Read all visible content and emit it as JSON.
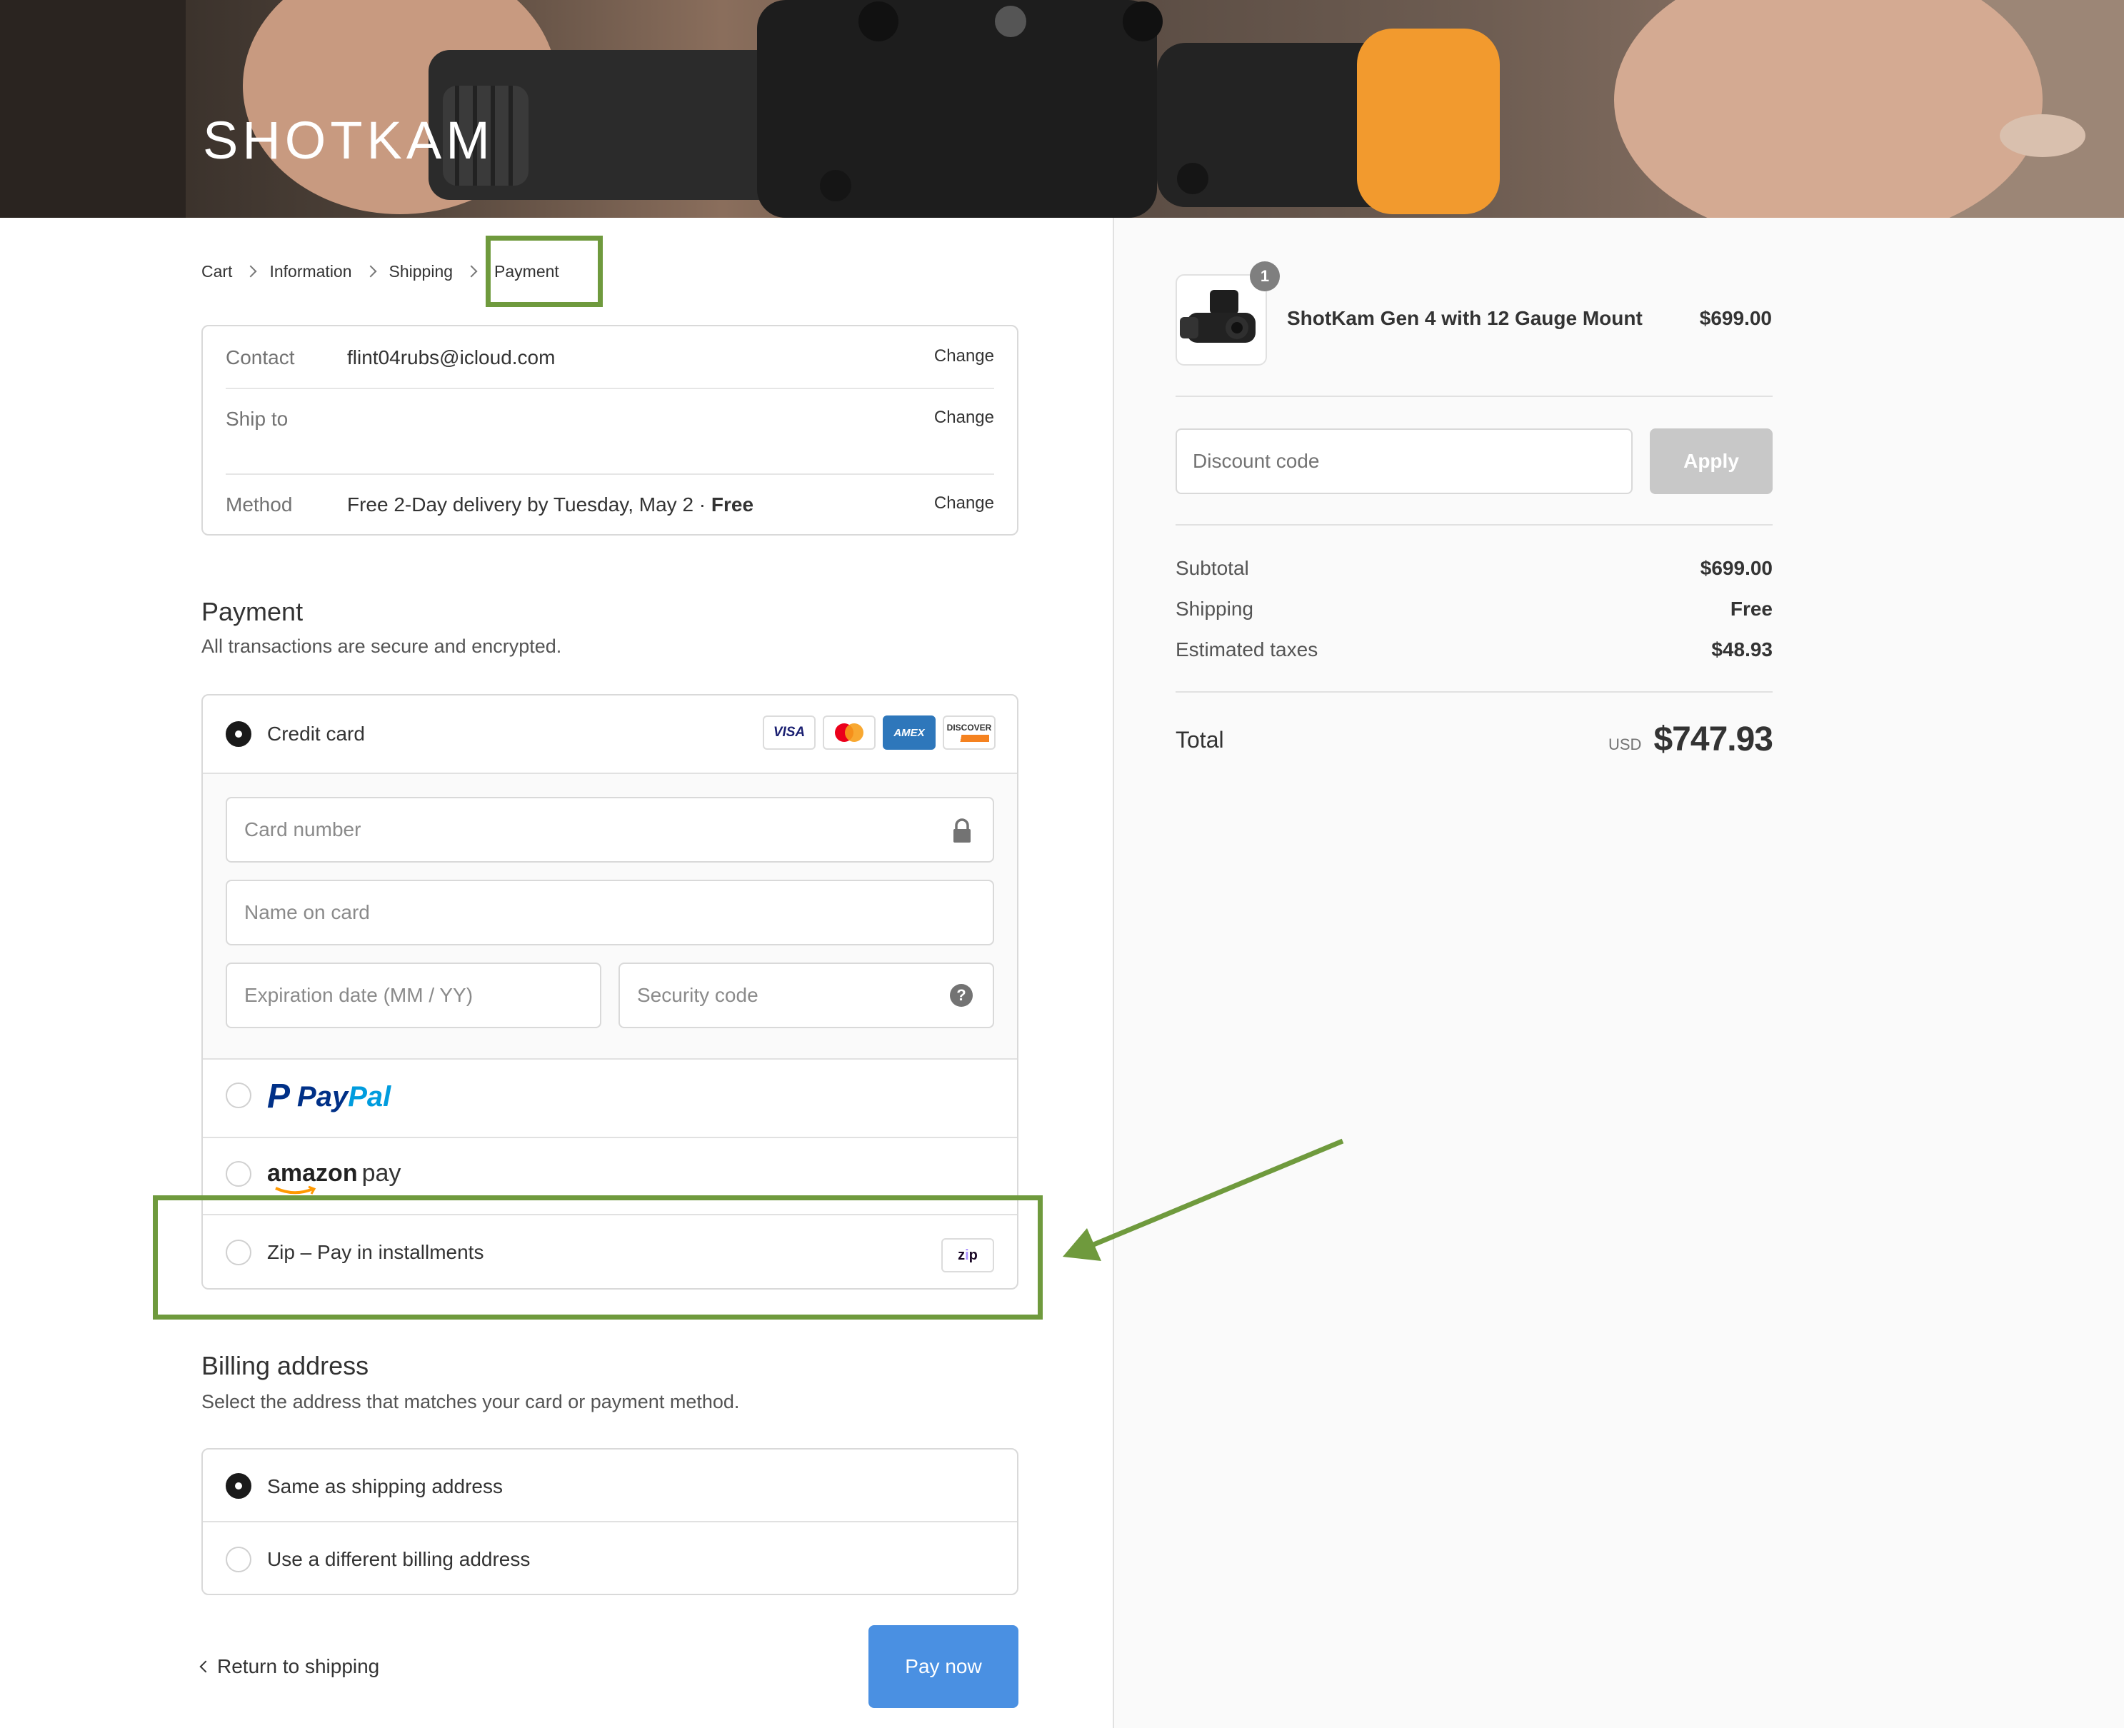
{
  "brand": {
    "logo_text": "SHOTKAM"
  },
  "breadcrumb": {
    "cart": "Cart",
    "information": "Information",
    "shipping": "Shipping",
    "payment": "Payment"
  },
  "review": {
    "contact_label": "Contact",
    "contact_value": "flint04rubs@icloud.com",
    "ship_to_label": "Ship to",
    "ship_to_value": "",
    "method_label": "Method",
    "method_value": "Free 2-Day delivery by Tuesday, May 2 ·",
    "method_price": "Free",
    "change_label": "Change"
  },
  "payment": {
    "title": "Payment",
    "subtitle": "All transactions are secure and encrypted.",
    "credit_card_label": "Credit card",
    "card_badges": {
      "visa": "VISA",
      "amex": "AMEX",
      "discover": "DISCOVER"
    },
    "card_number_placeholder": "Card number",
    "name_placeholder": "Name on card",
    "expiration_placeholder": "Expiration date (MM / YY)",
    "security_placeholder": "Security code",
    "paypal": {
      "pay": "Pay",
      "pal": "Pal",
      "p": "P"
    },
    "amazon": {
      "word": "amazon",
      "pay": "pay"
    },
    "zip_label": "Zip – Pay in installments",
    "zip_badge": {
      "z": "z",
      "i": "i",
      "p": "p"
    },
    "selected": "credit_card"
  },
  "billing": {
    "title": "Billing address",
    "subtitle": "Select the address that matches your card or payment method.",
    "same_label": "Same as shipping address",
    "different_label": "Use a different billing address",
    "selected": "same"
  },
  "actions": {
    "return_label": "Return to shipping",
    "pay_now_label": "Pay now"
  },
  "summary": {
    "product_name": "ShotKam Gen 4 with 12 Gauge Mount",
    "product_price": "$699.00",
    "quantity": "1",
    "discount_placeholder": "Discount code",
    "apply_label": "Apply",
    "subtotal_label": "Subtotal",
    "subtotal_value": "$699.00",
    "shipping_label": "Shipping",
    "shipping_value": "Free",
    "taxes_label": "Estimated taxes",
    "taxes_value": "$48.93",
    "total_label": "Total",
    "total_currency": "USD",
    "total_value": "$747.93"
  },
  "colors": {
    "accent_button": "#4a90e2",
    "annotation_green": "#6f9a3d",
    "apply_disabled": "#c8c8c8"
  }
}
